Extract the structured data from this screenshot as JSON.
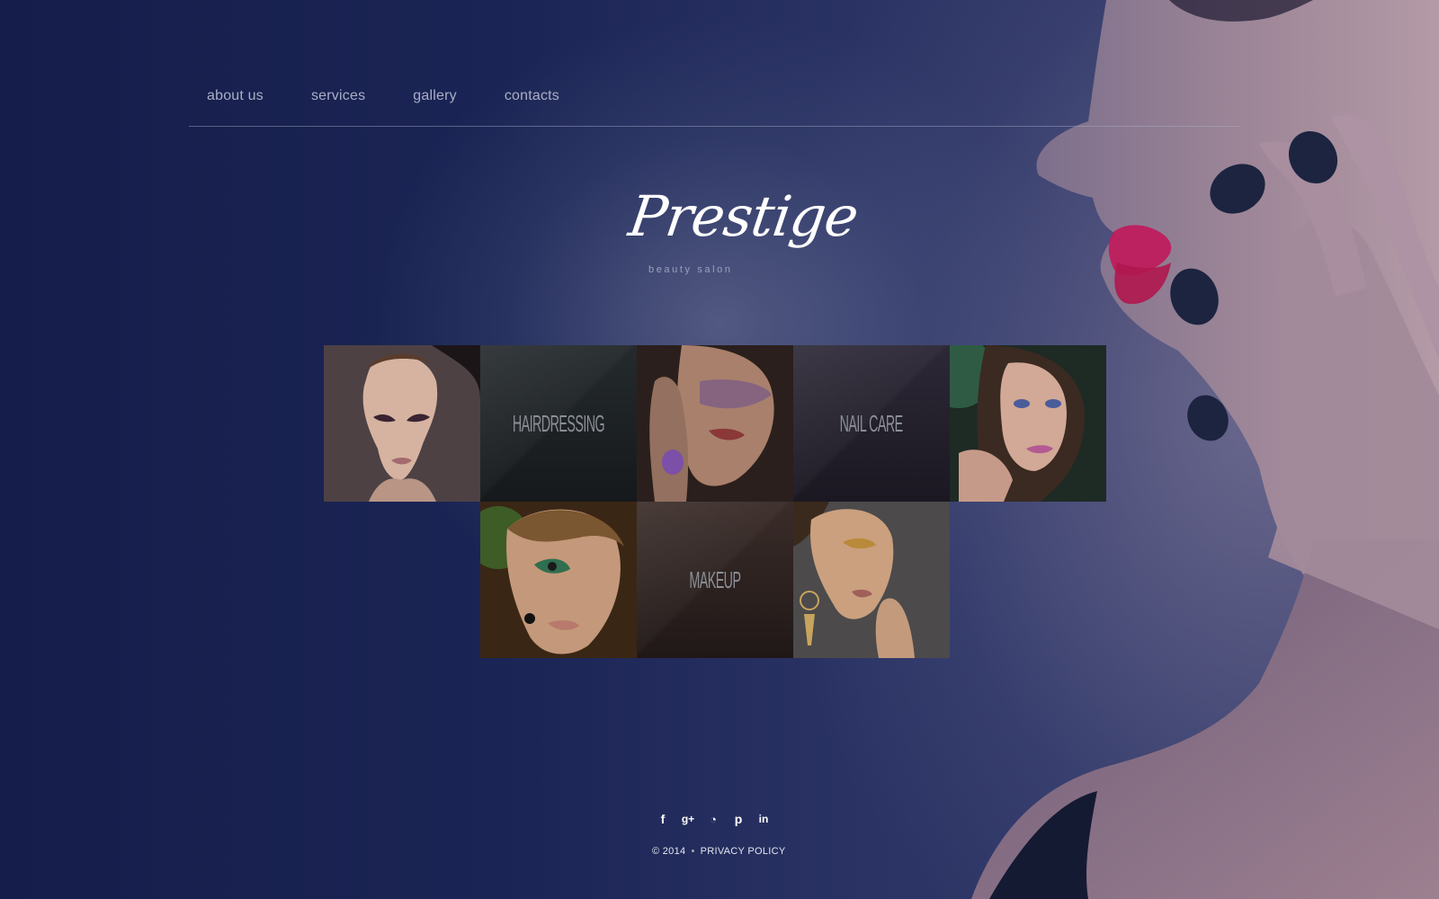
{
  "nav": {
    "items": [
      {
        "label": "about us"
      },
      {
        "label": "services"
      },
      {
        "label": "gallery"
      },
      {
        "label": "contacts"
      }
    ]
  },
  "logo": {
    "name": "Prestige",
    "tagline": "beauty salon"
  },
  "grid": {
    "labels": {
      "hairdressing": "HAIRDRESSING",
      "nail_care": "NAIL CARE",
      "makeup": "MAKEUP"
    }
  },
  "social": {
    "icons": [
      "facebook-icon",
      "google-plus-icon",
      "rss-icon",
      "pinterest-icon",
      "linkedin-icon"
    ],
    "glyphs": {
      "facebook": "f",
      "google_plus": "g+",
      "rss": "◔",
      "pinterest": "p",
      "linkedin": "in"
    }
  },
  "footer": {
    "copyright": "© 2014",
    "separator": "•",
    "privacy": "PRIVACY POLICY"
  },
  "colors": {
    "background": "#1b2452",
    "nav_text": "#a9aec6",
    "lips": "#c2185b",
    "nails": "#1c2440"
  }
}
